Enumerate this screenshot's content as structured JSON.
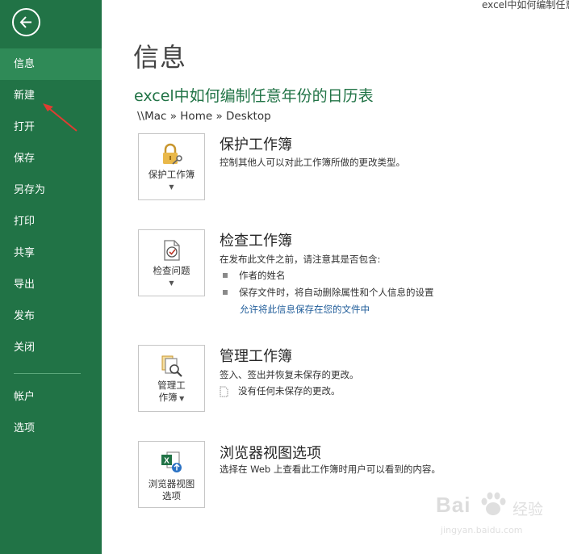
{
  "window": {
    "title": "excel中如何编制任意"
  },
  "sidebar": {
    "back_icon": "back-arrow-icon",
    "items": [
      {
        "label": "信息",
        "active": true
      },
      {
        "label": "新建"
      },
      {
        "label": "打开"
      },
      {
        "label": "保存"
      },
      {
        "label": "另存为"
      },
      {
        "label": "打印"
      },
      {
        "label": "共享"
      },
      {
        "label": "导出"
      },
      {
        "label": "发布"
      },
      {
        "label": "关闭"
      },
      {
        "label": "帐户"
      },
      {
        "label": "选项"
      }
    ],
    "colors": {
      "background": "#217346",
      "active": "#2f8a57"
    }
  },
  "main": {
    "title": "信息",
    "document_name": "excel中如何编制任意年份的日历表",
    "path": "\\\\Mac » Home » Desktop",
    "sections": [
      {
        "tile_label": "保护工作簿",
        "tile_icon": "lock-key-icon",
        "title": "保护工作簿",
        "description": "控制其他人可以对此工作簿所做的更改类型。"
      },
      {
        "tile_label": "检查问题",
        "tile_icon": "inspect-document-icon",
        "title": "检查工作簿",
        "description": "在发布此文件之前，请注意其是否包含:",
        "bullets": [
          "作者的姓名",
          "保存文件时，将自动删除属性和个人信息的设置"
        ],
        "link": "允许将此信息保存在您的文件中"
      },
      {
        "tile_label_line1": "管理工",
        "tile_label_line2": "作簿",
        "tile_icon": "manage-workbook-icon",
        "title": "管理工作簿",
        "description": "签入、签出并恢复未保存的更改。",
        "note": "没有任何未保存的更改。"
      },
      {
        "tile_label_line1": "浏览器视图",
        "tile_label_line2": "选项",
        "tile_icon": "excel-browser-icon",
        "title": "浏览器视图选项",
        "description": "选择在 Web 上查看此工作簿时用户可以看到的内容。"
      }
    ],
    "accent_color": "#217346",
    "link_color": "#1f5c99"
  },
  "annotation": {
    "arrow_color": "#e03c31"
  },
  "watermark": {
    "brand": "Bai",
    "brand_cn": "经验",
    "url": "jingyan.baidu.com"
  }
}
